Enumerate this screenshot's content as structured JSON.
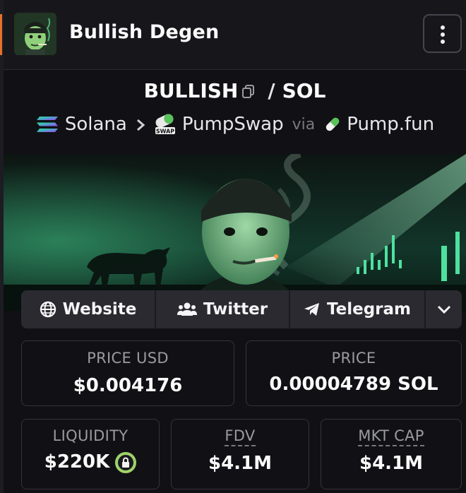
{
  "header": {
    "title": "Bullish Degen",
    "menu_icon": "vertical-dots-icon"
  },
  "pair": {
    "base": "BULLISH",
    "separator": "/",
    "quote": "SOL"
  },
  "chain": {
    "network": "Solana",
    "dex": "PumpSwap",
    "dex_badge": "SWAP",
    "via_label": "via",
    "launchpad": "Pump.fun"
  },
  "links": {
    "website": "Website",
    "twitter": "Twitter",
    "telegram": "Telegram"
  },
  "stats": {
    "price_usd_label": "PRICE USD",
    "price_usd_value": "$0.004176",
    "price_label": "PRICE",
    "price_value": "0.00004789 SOL",
    "liquidity_label": "LIQUIDITY",
    "liquidity_value": "$220K",
    "fdv_label": "FDV",
    "fdv_value": "$4.1M",
    "mktcap_label": "MKT CAP",
    "mktcap_value": "$4.1M"
  },
  "colors": {
    "accent_orange": "#e8702a",
    "lock_green": "#9fd36a",
    "banner_green": "#3fbf80"
  }
}
